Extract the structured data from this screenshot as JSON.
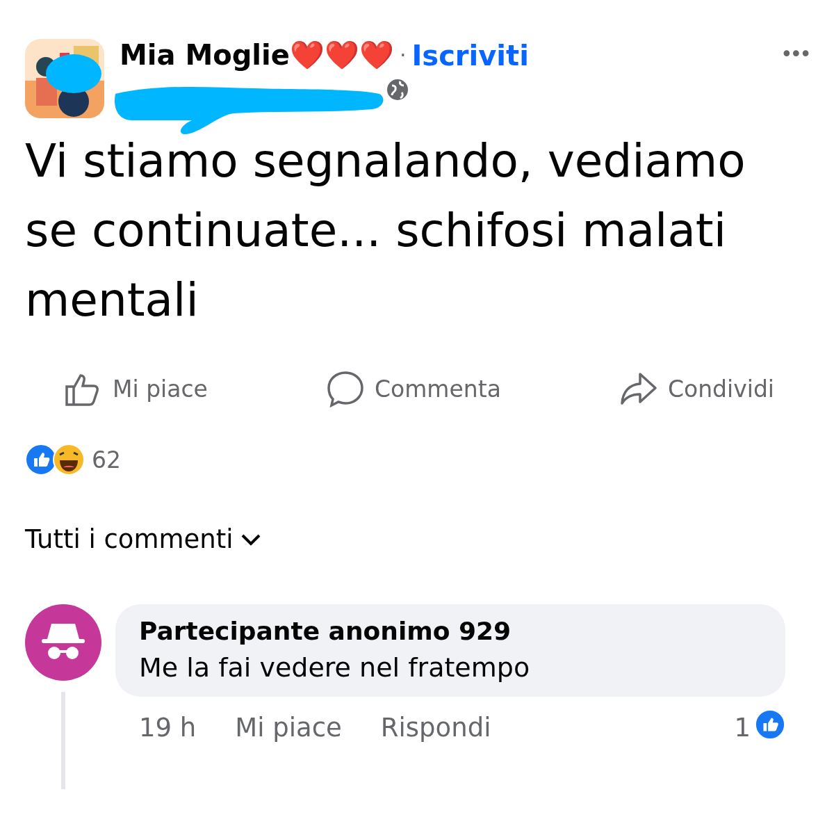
{
  "post": {
    "author": "Mia Moglie❤️❤️❤️",
    "separator": "·",
    "follow": "Iscriviti",
    "more": "•••",
    "text": "Vi stiamo segnalando, vediamo se continuate... schifosi malati mentali"
  },
  "actions": [
    {
      "kind": "like",
      "label": "Mi piace"
    },
    {
      "kind": "comment",
      "label": "Commenta"
    },
    {
      "kind": "share",
      "label": "Condividi"
    }
  ],
  "reactions": {
    "count": "62"
  },
  "comments_filter": {
    "label": "Tutti i commenti"
  },
  "comments": [
    {
      "author": "Partecipante anonimo 929",
      "text": "Me la fai vedere nel fratempo",
      "time": "19 h",
      "like": "Mi piace",
      "reply": "Rispondi",
      "likes": "1"
    }
  ]
}
